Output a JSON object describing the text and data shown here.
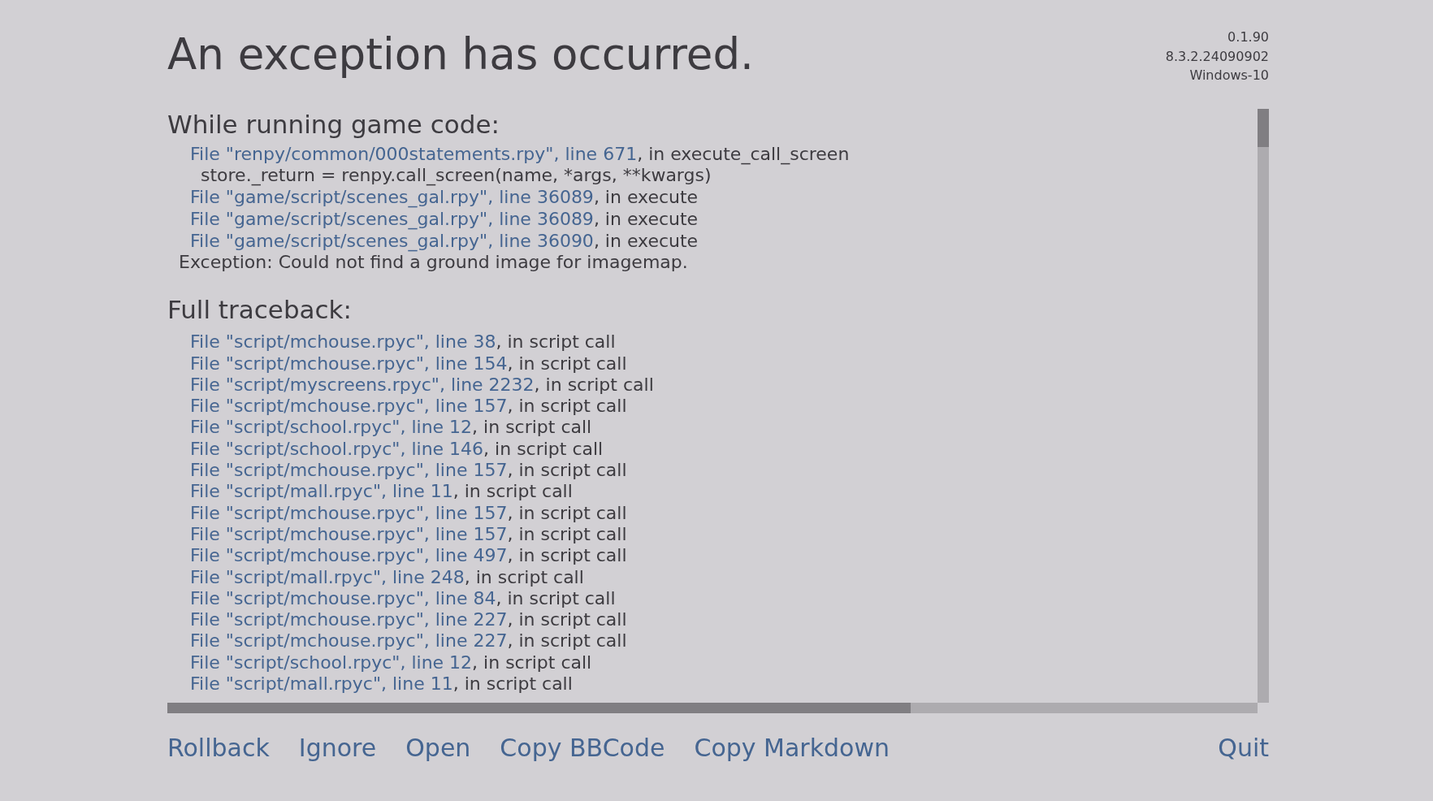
{
  "header": {
    "title": "An exception has occurred.",
    "version_info": [
      "0.1.90",
      "8.3.2.24090902",
      "Windows-10"
    ]
  },
  "sections": [
    {
      "heading": "While running game code:",
      "lines": [
        {
          "kind": "frame",
          "location": "File \"renpy/common/000statements.rpy\", line 671",
          "context": ", in execute_call_screen"
        },
        {
          "kind": "source",
          "text": "store._return = renpy.call_screen(name, *args, **kwargs)"
        },
        {
          "kind": "frame",
          "location": "File \"game/script/scenes_gal.rpy\", line 36089",
          "context": ", in execute"
        },
        {
          "kind": "frame",
          "location": "File \"game/script/scenes_gal.rpy\", line 36089",
          "context": ", in execute"
        },
        {
          "kind": "frame",
          "location": "File \"game/script/scenes_gal.rpy\", line 36090",
          "context": ", in execute"
        },
        {
          "kind": "exception",
          "text": "Exception: Could not find a ground image for imagemap."
        }
      ]
    },
    {
      "heading": "Full traceback:",
      "lines": [
        {
          "kind": "frame",
          "location": "File \"script/mchouse.rpyc\", line 38",
          "context": ", in script call"
        },
        {
          "kind": "frame",
          "location": "File \"script/mchouse.rpyc\", line 154",
          "context": ", in script call"
        },
        {
          "kind": "frame",
          "location": "File \"script/myscreens.rpyc\", line 2232",
          "context": ", in script call"
        },
        {
          "kind": "frame",
          "location": "File \"script/mchouse.rpyc\", line 157",
          "context": ", in script call"
        },
        {
          "kind": "frame",
          "location": "File \"script/school.rpyc\", line 12",
          "context": ", in script call"
        },
        {
          "kind": "frame",
          "location": "File \"script/school.rpyc\", line 146",
          "context": ", in script call"
        },
        {
          "kind": "frame",
          "location": "File \"script/mchouse.rpyc\", line 157",
          "context": ", in script call"
        },
        {
          "kind": "frame",
          "location": "File \"script/mall.rpyc\", line 11",
          "context": ", in script call"
        },
        {
          "kind": "frame",
          "location": "File \"script/mchouse.rpyc\", line 157",
          "context": ", in script call"
        },
        {
          "kind": "frame",
          "location": "File \"script/mchouse.rpyc\", line 157",
          "context": ", in script call"
        },
        {
          "kind": "frame",
          "location": "File \"script/mchouse.rpyc\", line 497",
          "context": ", in script call"
        },
        {
          "kind": "frame",
          "location": "File \"script/mall.rpyc\", line 248",
          "context": ", in script call"
        },
        {
          "kind": "frame",
          "location": "File \"script/mchouse.rpyc\", line 84",
          "context": ", in script call"
        },
        {
          "kind": "frame",
          "location": "File \"script/mchouse.rpyc\", line 227",
          "context": ", in script call"
        },
        {
          "kind": "frame",
          "location": "File \"script/mchouse.rpyc\", line 227",
          "context": ", in script call"
        },
        {
          "kind": "frame",
          "location": "File \"script/school.rpyc\", line 12",
          "context": ", in script call"
        },
        {
          "kind": "frame",
          "location": "File \"script/mall.rpyc\", line 11",
          "context": ", in script call"
        }
      ]
    }
  ],
  "actions": [
    "Rollback",
    "Ignore",
    "Open",
    "Copy BBCode",
    "Copy Markdown"
  ],
  "quit_button": "Quit"
}
